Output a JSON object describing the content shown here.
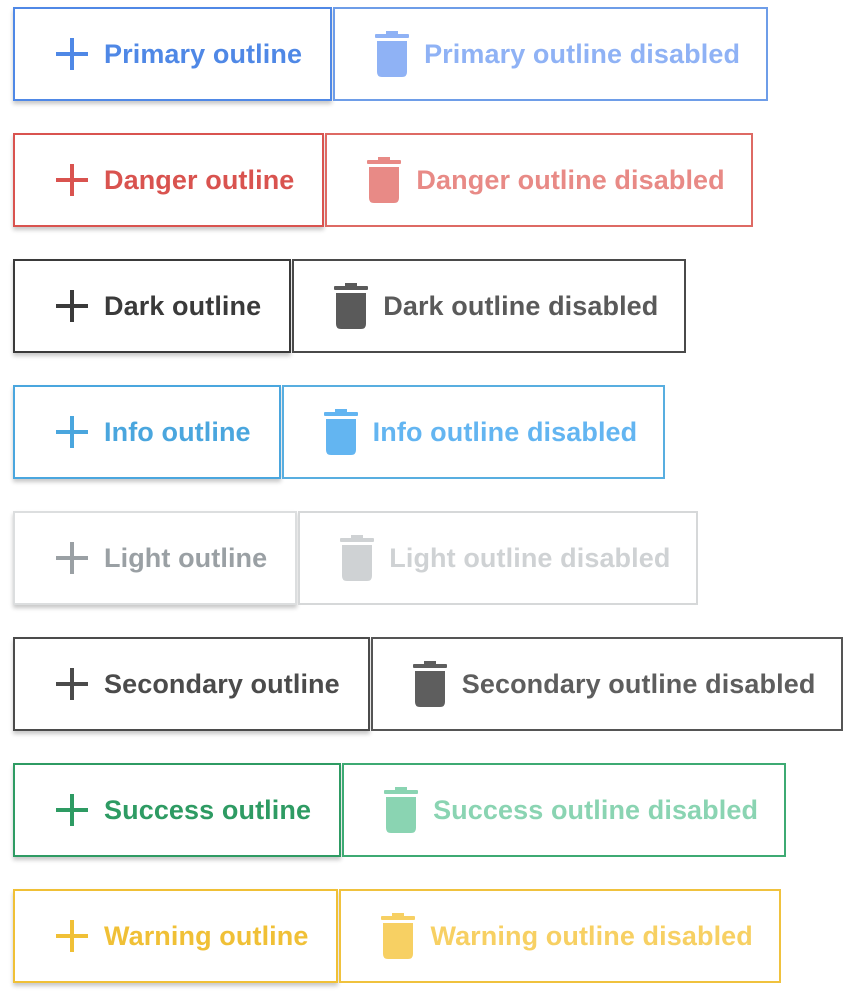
{
  "icons": {
    "enabled": "plus-icon",
    "disabled": "trash-icon"
  },
  "rows": {
    "primary": {
      "enabled_label": "Primary outline",
      "disabled_label": "Primary outline disabled",
      "color": "#4f88e6"
    },
    "danger": {
      "enabled_label": "Danger outline",
      "disabled_label": "Danger outline disabled",
      "color": "#d9534f"
    },
    "dark": {
      "enabled_label": "Dark outline",
      "disabled_label": "Dark outline disabled",
      "color": "#3a3a3a"
    },
    "info": {
      "enabled_label": "Info outline",
      "disabled_label": "Info outline disabled",
      "color": "#4aa6de"
    },
    "light": {
      "enabled_label": "Light outline",
      "disabled_label": "Light outline disabled",
      "color": "#9aa0a4"
    },
    "secondary": {
      "enabled_label": "Secondary outline",
      "disabled_label": "Secondary outline disabled",
      "color": "#4b4b4b"
    },
    "success": {
      "enabled_label": "Success outline",
      "disabled_label": "Success outline disabled",
      "color": "#2e9b63"
    },
    "warning": {
      "enabled_label": "Warning outline",
      "disabled_label": "Warning outline disabled",
      "color": "#f0c036"
    }
  }
}
